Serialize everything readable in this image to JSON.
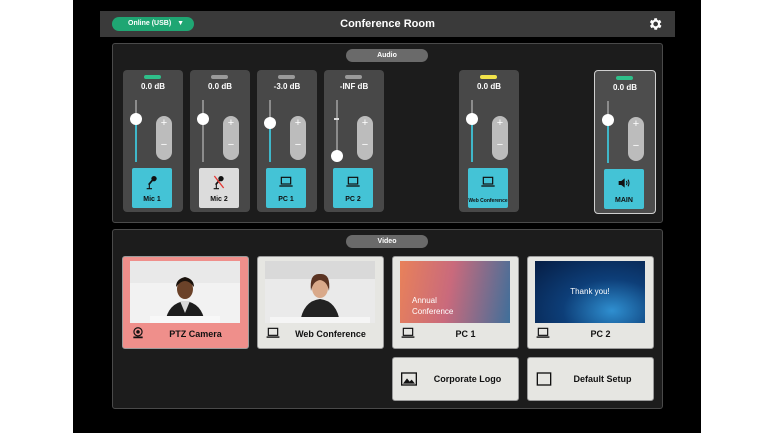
{
  "header": {
    "status": "Online (USB)",
    "status_caret": "▼",
    "title": "Conference Room",
    "settings_icon": "gear-icon",
    "status_color": "#1fa673"
  },
  "audio": {
    "section_label": "Audio",
    "channels": [
      {
        "id": "mic1",
        "name": "Mic 1",
        "db": "0.0 dB",
        "icon": "microphone-icon",
        "muted": false,
        "indicator": "green",
        "level": 0.69
      },
      {
        "id": "mic2",
        "name": "Mic 2",
        "db": "0.0 dB",
        "icon": "microphone-muted-icon",
        "muted": true,
        "indicator": "gray",
        "level": 0.69
      },
      {
        "id": "pc1",
        "name": "PC 1",
        "db": "-3.0 dB",
        "icon": "laptop-icon",
        "muted": false,
        "indicator": "gray",
        "level": 0.63
      },
      {
        "id": "pc2",
        "name": "PC 2",
        "db": "-INF dB",
        "icon": "laptop-icon",
        "muted": false,
        "indicator": "gray",
        "level": 0.0
      },
      {
        "id": "webconf",
        "name": "Web Conference",
        "db": "0.0 dB",
        "icon": "laptop-icon",
        "muted": false,
        "indicator": "yellow",
        "level": 0.69
      },
      {
        "id": "main",
        "name": "MAIN",
        "db": "0.0 dB",
        "icon": "speaker-icon",
        "muted": false,
        "indicator": "green",
        "level": 0.69
      }
    ],
    "trim_plus": "+",
    "trim_minus": "−"
  },
  "video": {
    "section_label": "Video",
    "sources": [
      {
        "name": "PTZ Camera",
        "icon": "ptz-camera-icon",
        "active": true
      },
      {
        "name": "Web Conference",
        "icon": "laptop-icon",
        "active": false
      },
      {
        "name": "PC 1",
        "icon": "laptop-icon",
        "active": false
      },
      {
        "name": "PC 2",
        "icon": "laptop-icon",
        "active": false
      }
    ],
    "pc1_slide_line1": "Annual",
    "pc1_slide_line2": "Conference",
    "pc2_slide_text": "Thank you!",
    "actions": [
      {
        "name": "Corporate Logo",
        "icon": "image-icon"
      },
      {
        "name": "Default Setup",
        "icon": "blank-square-icon"
      }
    ]
  },
  "colors": {
    "accent_cyan": "#44c3d6",
    "active_source": "#ef8f8b",
    "indicator_green": "#2fbf8a",
    "indicator_yellow": "#f2e34a"
  }
}
